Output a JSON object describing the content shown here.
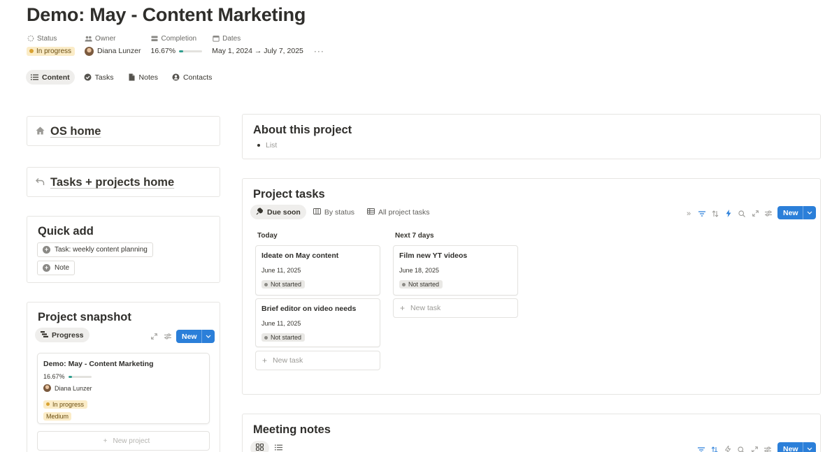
{
  "page": {
    "title": "Demo: May - Content Marketing"
  },
  "properties": {
    "status": {
      "label": "Status",
      "value": "In progress"
    },
    "owner": {
      "label": "Owner",
      "value": "Diana Lunzer"
    },
    "completion": {
      "label": "Completion",
      "value": "16.67%",
      "fraction": 0.1667
    },
    "dates": {
      "label": "Dates",
      "value": "May 1, 2024 → July 7, 2025"
    },
    "more": "···"
  },
  "tabs": [
    {
      "label": "Content",
      "active": true,
      "icon": "list-icon"
    },
    {
      "label": "Tasks",
      "active": false,
      "icon": "check-circle-icon"
    },
    {
      "label": "Notes",
      "active": false,
      "icon": "document-icon"
    },
    {
      "label": "Contacts",
      "active": false,
      "icon": "person-circle-icon"
    }
  ],
  "sidebar": {
    "os_home": {
      "label": "OS home",
      "icon": "home-icon"
    },
    "tasks_home": {
      "label": "Tasks + projects home",
      "icon": "return-arrow-icon"
    },
    "quick_add": {
      "title": "Quick add",
      "buttons": [
        {
          "label": "Task: weekly content planning",
          "icon": "plus-circle-icon"
        },
        {
          "label": "Note",
          "icon": "plus-circle-icon"
        }
      ]
    },
    "snapshot": {
      "title": "Project snapshot",
      "view_label": "Progress",
      "new_label": "New",
      "card": {
        "title": "Demo: May - Content Marketing",
        "completion": "16.67%",
        "fraction": 0.1667,
        "owner": "Diana Lunzer",
        "status": "In progress",
        "priority": "Medium"
      },
      "new_project": "New project"
    }
  },
  "about": {
    "title": "About this project",
    "items": [
      "List"
    ]
  },
  "project_tasks": {
    "title": "Project tasks",
    "views": [
      {
        "label": "Due soon",
        "active": true,
        "icon": "alarm-icon"
      },
      {
        "label": "By status",
        "active": false,
        "icon": "board-icon"
      },
      {
        "label": "All project tasks",
        "active": false,
        "icon": "table-icon"
      }
    ],
    "new_label": "New",
    "columns": [
      {
        "name": "Today",
        "cards": [
          {
            "title": "Ideate on May content",
            "date": "June 11, 2025",
            "status": "Not started"
          },
          {
            "title": "Brief editor on video needs",
            "date": "June 11, 2025",
            "status": "Not started"
          }
        ],
        "new_task": "New task"
      },
      {
        "name": "Next 7 days",
        "cards": [
          {
            "title": "Film new YT videos",
            "date": "June 18, 2025",
            "status": "Not started"
          }
        ],
        "new_task": "New task"
      }
    ]
  },
  "meeting_notes": {
    "title": "Meeting notes",
    "new_label": "New"
  },
  "colors": {
    "accent": "#2b7fd9",
    "status_in_progress_bg": "#fbecc7",
    "status_not_started_bg": "#e9e8e5"
  }
}
